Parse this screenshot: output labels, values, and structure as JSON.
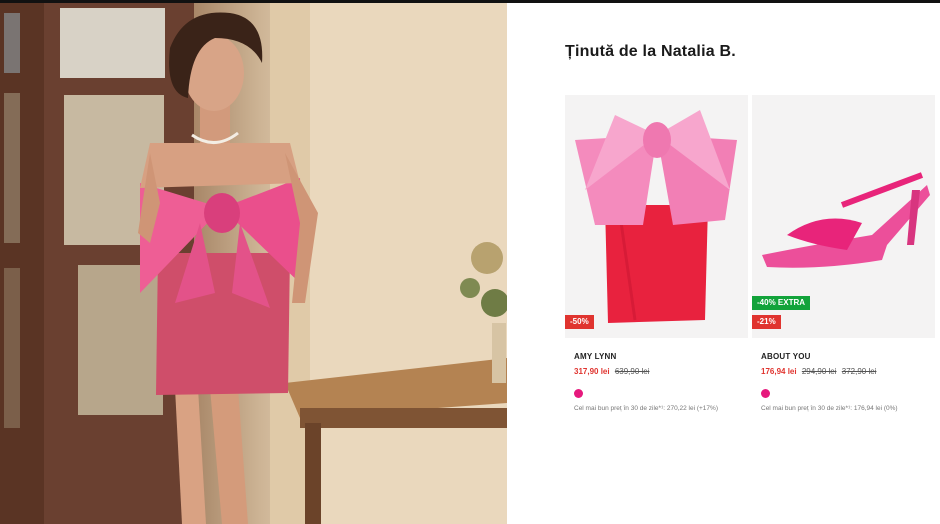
{
  "outfit": {
    "title": "Ținută de la Natalia B."
  },
  "products": [
    {
      "brand": "AMY LYNN",
      "price": "317,90 lei",
      "old_prices": [
        "639,90 lei"
      ],
      "badges": [
        "-50%"
      ],
      "color": "#e6197d",
      "best_price_note": "Cel mai bun preț în 30 de zile*¹: 270,22 lei (+17%)"
    },
    {
      "brand": "ABOUT YOU",
      "price": "176,94 lei",
      "old_prices": [
        "294,90 lei",
        "372,90 lei"
      ],
      "badges": [
        "-40% EXTRA",
        "-21%"
      ],
      "color": "#e6197d",
      "best_price_note": "Cel mai bun preț în 30 de zile*¹: 176,94 lei (0%)"
    }
  ],
  "colors": {
    "sale_red": "#e0342f",
    "extra_green": "#12a33a",
    "swatch_pink": "#e6197d"
  }
}
